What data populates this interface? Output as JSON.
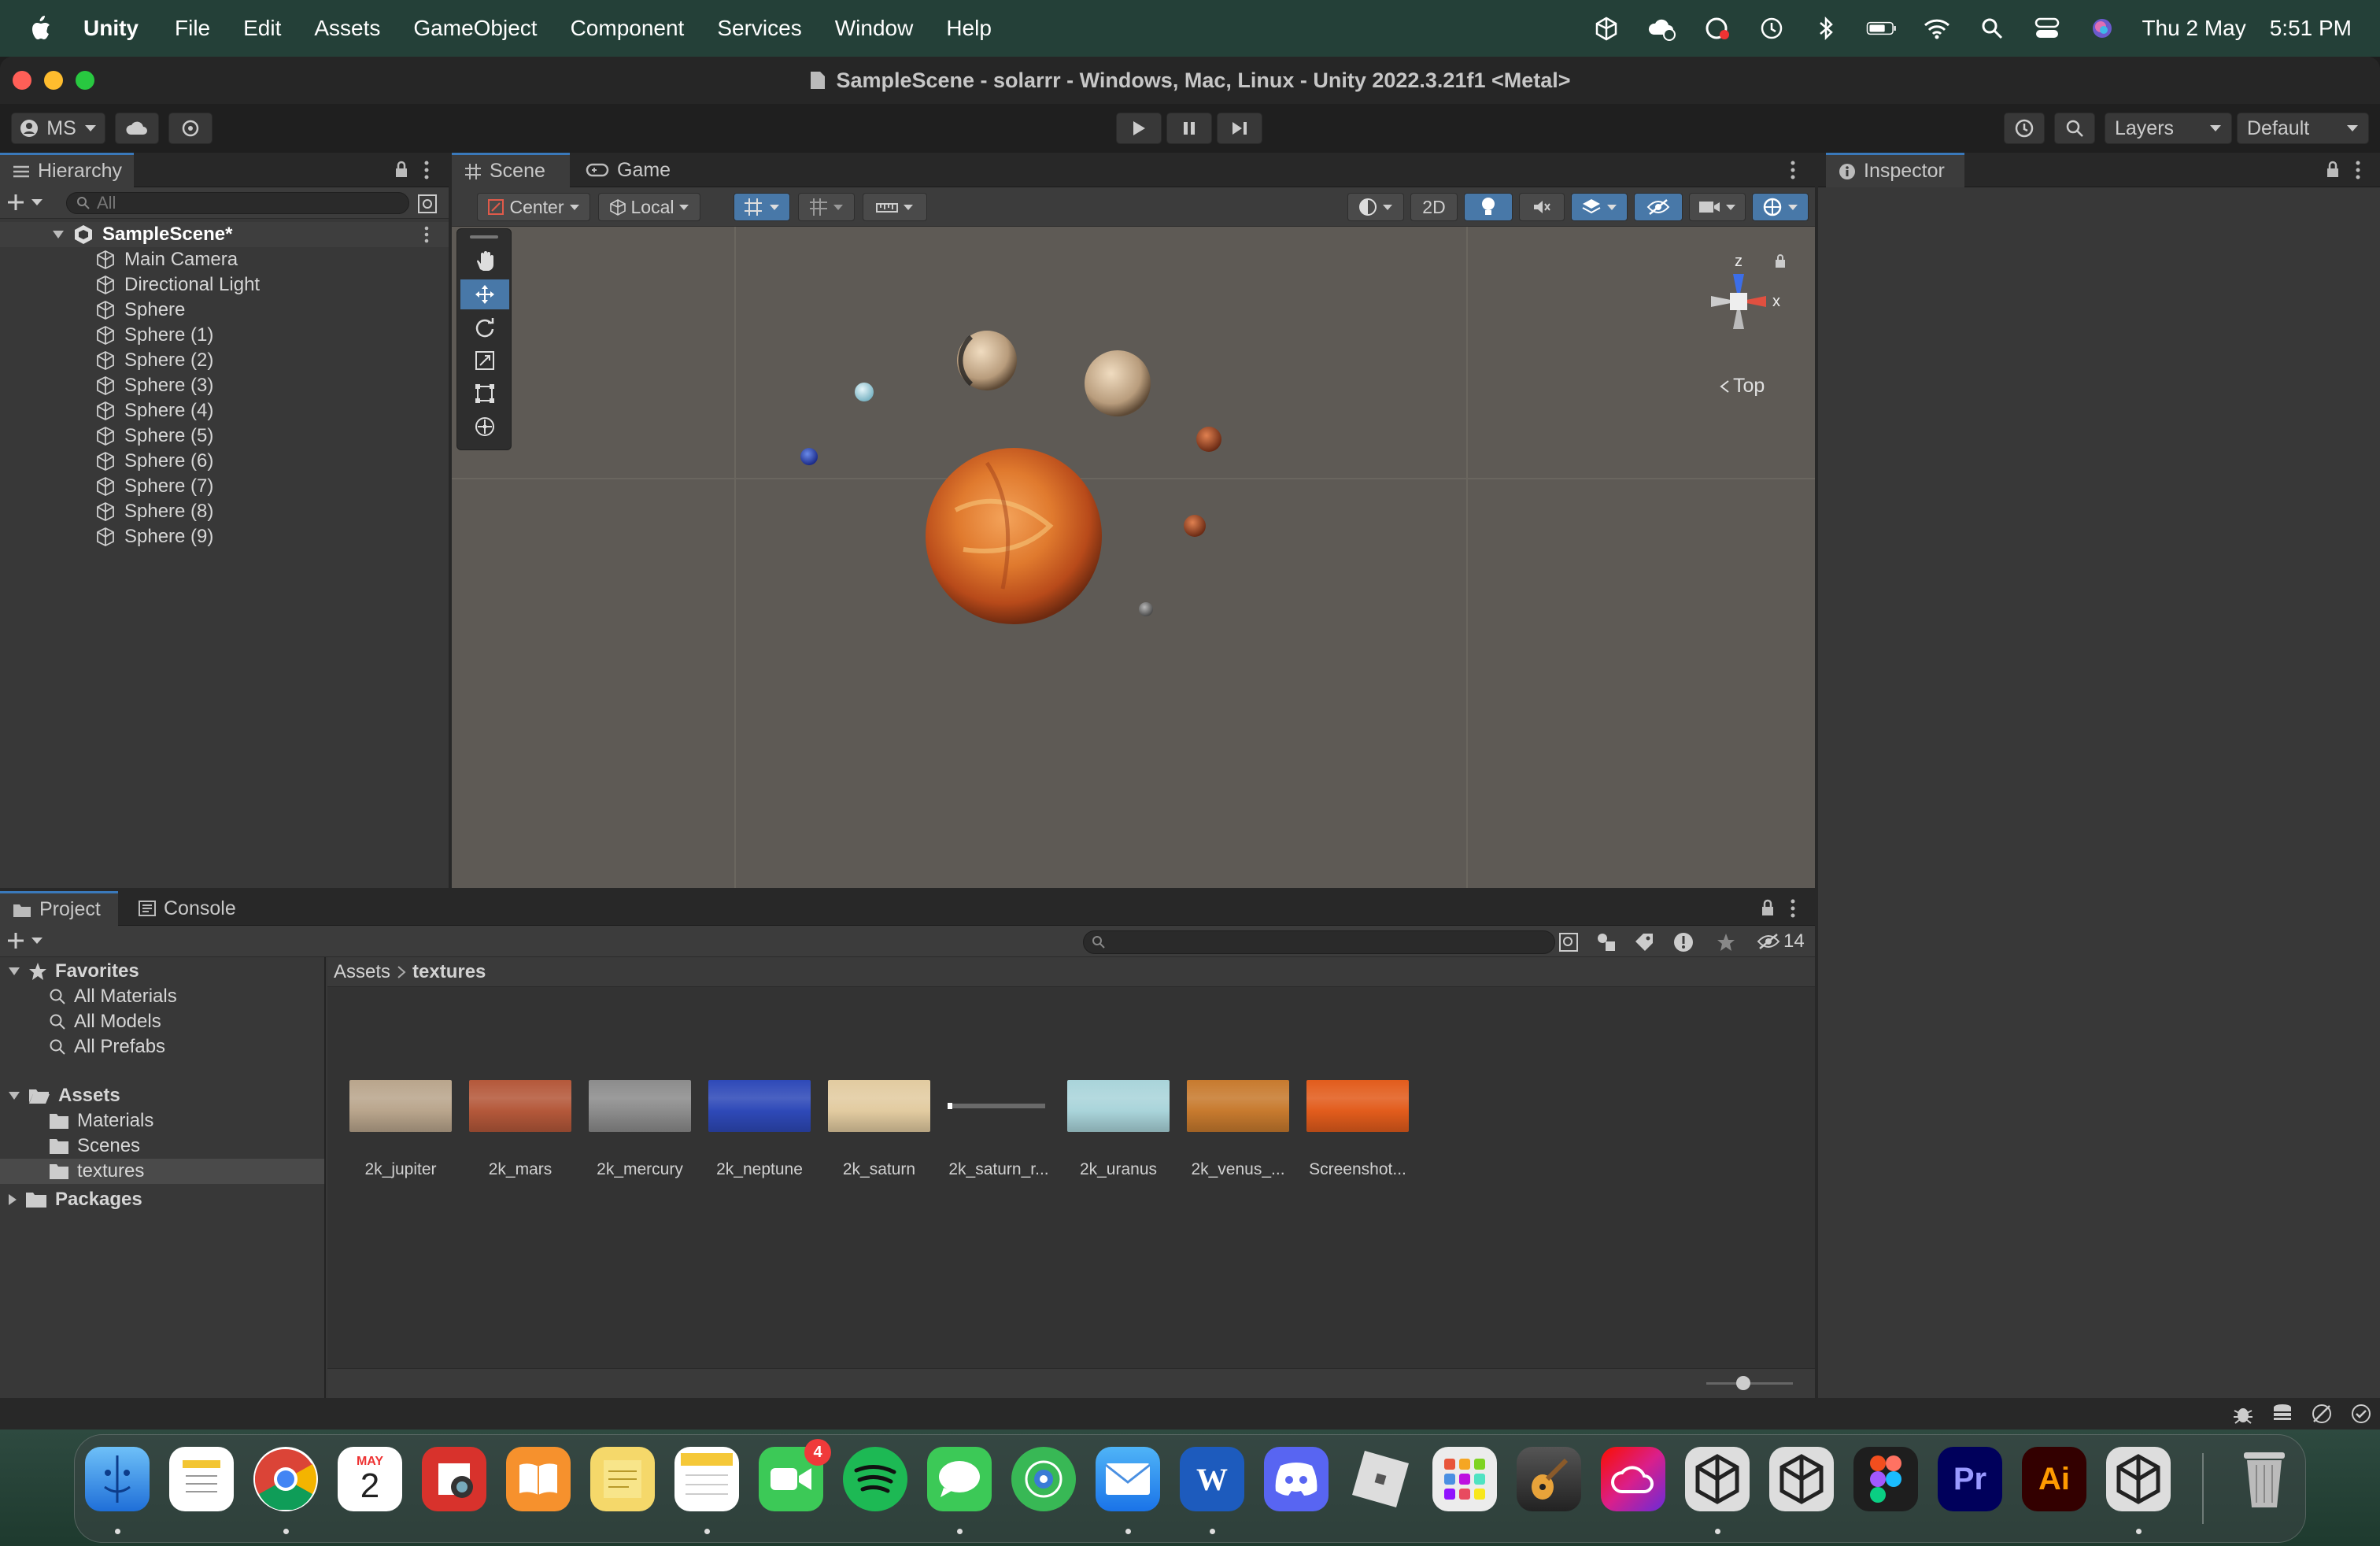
{
  "menubar": {
    "app": "Unity",
    "items": [
      "File",
      "Edit",
      "Assets",
      "GameObject",
      "Component",
      "Services",
      "Window",
      "Help"
    ],
    "date": "Thu 2 May",
    "time": "5:51 PM"
  },
  "window": {
    "title": "SampleScene - solarrr - Windows, Mac, Linux - Unity 2022.3.21f1 <Metal>"
  },
  "toolbar": {
    "account": "MS",
    "layers": "Layers",
    "layout": "Default"
  },
  "hierarchy": {
    "tab": "Hierarchy",
    "search_placeholder": "All",
    "scene": "SampleScene*",
    "items": [
      "Main Camera",
      "Directional Light",
      "Sphere",
      "Sphere (1)",
      "Sphere (2)",
      "Sphere (3)",
      "Sphere (4)",
      "Sphere (5)",
      "Sphere (6)",
      "Sphere (7)",
      "Sphere (8)",
      "Sphere (9)"
    ]
  },
  "scene": {
    "tabs": [
      "Scene",
      "Game"
    ],
    "pivot": "Center",
    "space": "Local",
    "mode2d": "2D",
    "gizmo_view": "Top",
    "gizmo_axes": {
      "z": "z",
      "x": "x"
    }
  },
  "inspector": {
    "tab": "Inspector"
  },
  "project": {
    "tabs": [
      "Project",
      "Console"
    ],
    "hidden_count": "14",
    "breadcrumb": [
      "Assets",
      "textures"
    ],
    "favorites": {
      "label": "Favorites",
      "items": [
        "All Materials",
        "All Models",
        "All Prefabs"
      ]
    },
    "assets": {
      "label": "Assets",
      "items": [
        "Materials",
        "Scenes",
        "textures"
      ]
    },
    "packages": "Packages",
    "files": [
      {
        "name": "2k_jupiter",
        "color": "#b9a58c"
      },
      {
        "name": "2k_mars",
        "color": "#b4583a"
      },
      {
        "name": "2k_mercury",
        "color": "#8c8c8c"
      },
      {
        "name": "2k_neptune",
        "color": "#2e49b8"
      },
      {
        "name": "2k_saturn",
        "color": "#e2cba0"
      },
      {
        "name": "2k_saturn_r...",
        "color": "#6a6a6a"
      },
      {
        "name": "2k_uranus",
        "color": "#a9d4da"
      },
      {
        "name": "2k_venus_...",
        "color": "#c77a2e"
      },
      {
        "name": "Screenshot...",
        "color": "#e25c1c"
      }
    ]
  },
  "dock": {
    "calendar_month": "MAY",
    "calendar_day": "2",
    "facetime_badge": "4",
    "apps": [
      "Finder",
      "Notes",
      "Chrome",
      "Calendar",
      "Photo Booth",
      "Books",
      "Stickies",
      "Notes",
      "FaceTime",
      "Spotify",
      "Messages",
      "Find My",
      "Mail",
      "Word",
      "Discord",
      "Roblox",
      "Launchpad",
      "GarageBand",
      "Creative Cloud",
      "Unity Hub",
      "Unity",
      "Figma",
      "Premiere Pro",
      "Illustrator",
      "Unity",
      "Trash"
    ],
    "labels": {
      "word": "W",
      "premiere": "Pr",
      "illustrator": "Ai"
    }
  },
  "colors": {
    "accent": "#3a79bb",
    "sun": "#e07a2e",
    "scene_bg": "#5e5a55"
  }
}
